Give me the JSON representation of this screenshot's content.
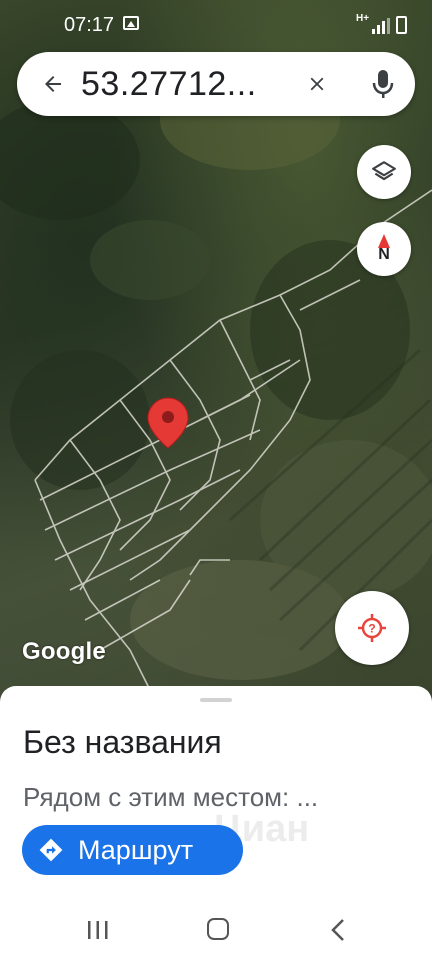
{
  "status_bar": {
    "time": "07:17",
    "network_label": "H+",
    "icons": [
      "image-icon",
      "network-icon",
      "signal-icon",
      "battery-icon"
    ]
  },
  "search": {
    "query": "53.27712...",
    "icons": [
      "back-arrow-icon",
      "close-icon",
      "mic-icon"
    ]
  },
  "map": {
    "logo": "Google",
    "compass_label": "N",
    "marker_color": "#e53935",
    "controls": [
      "layers-icon",
      "compass-icon",
      "my-location-icon"
    ]
  },
  "place": {
    "title": "Без названия",
    "subtitle": "Рядом с этим местом: ...",
    "route_label": "Маршрут",
    "watermark": "Циан"
  },
  "nav_bar": {
    "icons": [
      "recent-apps-icon",
      "home-icon",
      "back-icon"
    ]
  },
  "colors": {
    "accent": "#1a73e8",
    "location_icon": "#e8453c"
  }
}
